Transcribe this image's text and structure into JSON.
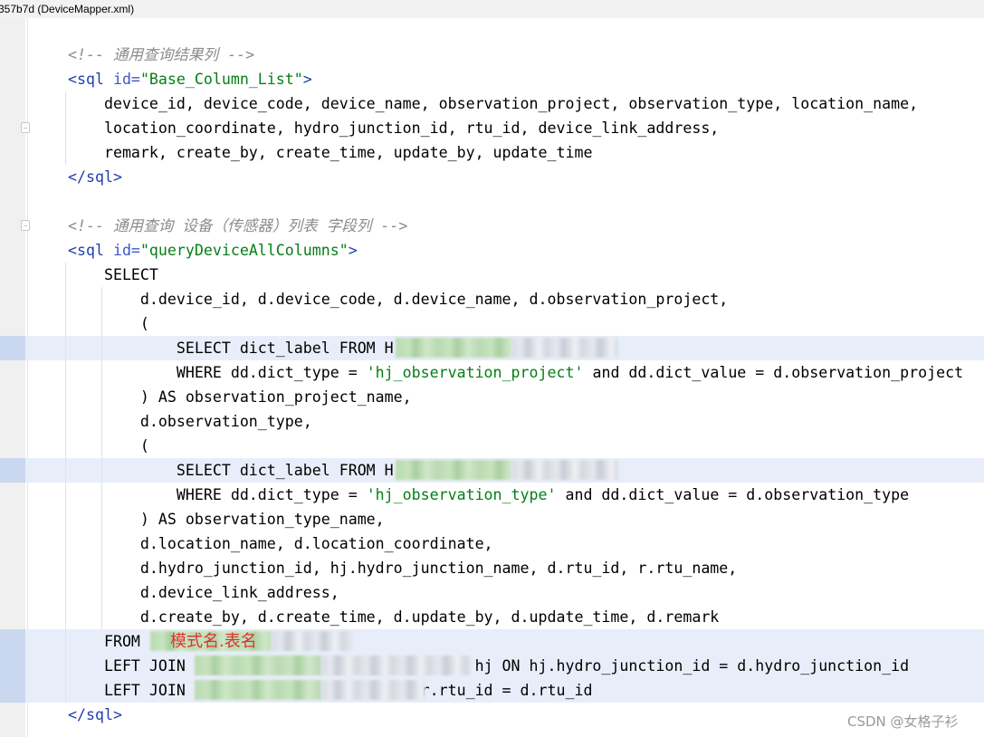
{
  "window": {
    "title": "357b7d (DeviceMapper.xml)"
  },
  "editor": {
    "lines": [
      {
        "parts": [
          {
            "cls": "cm",
            "text": "<!-- 通用查询结果列 -->"
          }
        ]
      },
      {
        "parts": [
          {
            "cls": "tag",
            "text": "<sql "
          },
          {
            "cls": "attr",
            "text": "id="
          },
          {
            "cls": "aval",
            "text": "\"Base_Column_List\""
          },
          {
            "cls": "tag",
            "text": ">"
          }
        ]
      },
      {
        "parts": [
          {
            "cls": "kw",
            "text": "    device_id, device_code, device_name, observation_project, observation_type, location_name,"
          }
        ]
      },
      {
        "parts": [
          {
            "cls": "kw",
            "text": "    location_coordinate, hydro_junction_id, rtu_id, device_link_address,"
          }
        ]
      },
      {
        "parts": [
          {
            "cls": "kw",
            "text": "    remark, create_by, create_time, update_by, update_time"
          }
        ]
      },
      {
        "parts": [
          {
            "cls": "tag",
            "text": "</sql>"
          }
        ]
      },
      {
        "parts": [
          {
            "cls": "kw",
            "text": ""
          }
        ]
      },
      {
        "parts": [
          {
            "cls": "cm",
            "text": "<!-- 通用查询 设备（传感器）列表 字段列 -->"
          }
        ]
      },
      {
        "parts": [
          {
            "cls": "tag",
            "text": "<sql "
          },
          {
            "cls": "attr",
            "text": "id="
          },
          {
            "cls": "aval",
            "text": "\"queryDeviceAllColumns\""
          },
          {
            "cls": "tag",
            "text": ">"
          }
        ]
      },
      {
        "parts": [
          {
            "cls": "kw",
            "text": "    SELECT"
          }
        ]
      },
      {
        "parts": [
          {
            "cls": "kw",
            "text": "        d.device_id, d.device_code, d.device_name, d.observation_project,"
          }
        ]
      },
      {
        "parts": [
          {
            "cls": "kw",
            "text": "        ("
          }
        ]
      },
      {
        "parts": [
          {
            "cls": "kw",
            "text": "            SELECT dict_label FROM H            a AS dd"
          }
        ]
      },
      {
        "parts": [
          {
            "cls": "kw",
            "text": "            WHERE dd.dict_type = "
          },
          {
            "cls": "str",
            "text": "'hj_observation_project'"
          },
          {
            "cls": "kw",
            "text": " and dd.dict_value = d.observation_project"
          }
        ]
      },
      {
        "parts": [
          {
            "cls": "kw",
            "text": "        ) AS observation_project_name,"
          }
        ]
      },
      {
        "parts": [
          {
            "cls": "kw",
            "text": "        d.observation_type,"
          }
        ]
      },
      {
        "parts": [
          {
            "cls": "kw",
            "text": "        ("
          }
        ]
      },
      {
        "parts": [
          {
            "cls": "kw",
            "text": "            SELECT dict_label FROM H            a AS dd"
          }
        ]
      },
      {
        "parts": [
          {
            "cls": "kw",
            "text": "            WHERE dd.dict_type = "
          },
          {
            "cls": "str",
            "text": "'hj_observation_type'"
          },
          {
            "cls": "kw",
            "text": " and dd.dict_value = d.observation_type"
          }
        ]
      },
      {
        "parts": [
          {
            "cls": "kw",
            "text": "        ) AS observation_type_name,"
          }
        ]
      },
      {
        "parts": [
          {
            "cls": "kw",
            "text": "        d.location_name, d.location_coordinate,"
          }
        ]
      },
      {
        "parts": [
          {
            "cls": "kw",
            "text": "        d.hydro_junction_id, hj.hydro_junction_name, d.rtu_id, r.rtu_name,"
          }
        ]
      },
      {
        "parts": [
          {
            "cls": "kw",
            "text": "        d.device_link_address,"
          }
        ]
      },
      {
        "parts": [
          {
            "cls": "kw",
            "text": "        d.create_by, d.create_time, d.update_by, d.update_time, d.remark"
          }
        ]
      },
      {
        "parts": [
          {
            "cls": "kw",
            "text": "    FROM               e AS d"
          }
        ]
      },
      {
        "parts": [
          {
            "cls": "kw",
            "text": "    LEFT JOIN                           n AS hj ON hj.hydro_junction_id = d.hydro_junction_id"
          }
        ]
      },
      {
        "parts": [
          {
            "cls": "kw",
            "text": "    LEFT JOIN                       ON r.rtu_id = d.rtu_id"
          }
        ]
      },
      {
        "parts": [
          {
            "cls": "tag",
            "text": "</sql>"
          }
        ]
      }
    ]
  },
  "annotation": {
    "text": "模式名.表名",
    "color": "#e0322b"
  },
  "watermark": {
    "text": "CSDN @女格子衫"
  }
}
